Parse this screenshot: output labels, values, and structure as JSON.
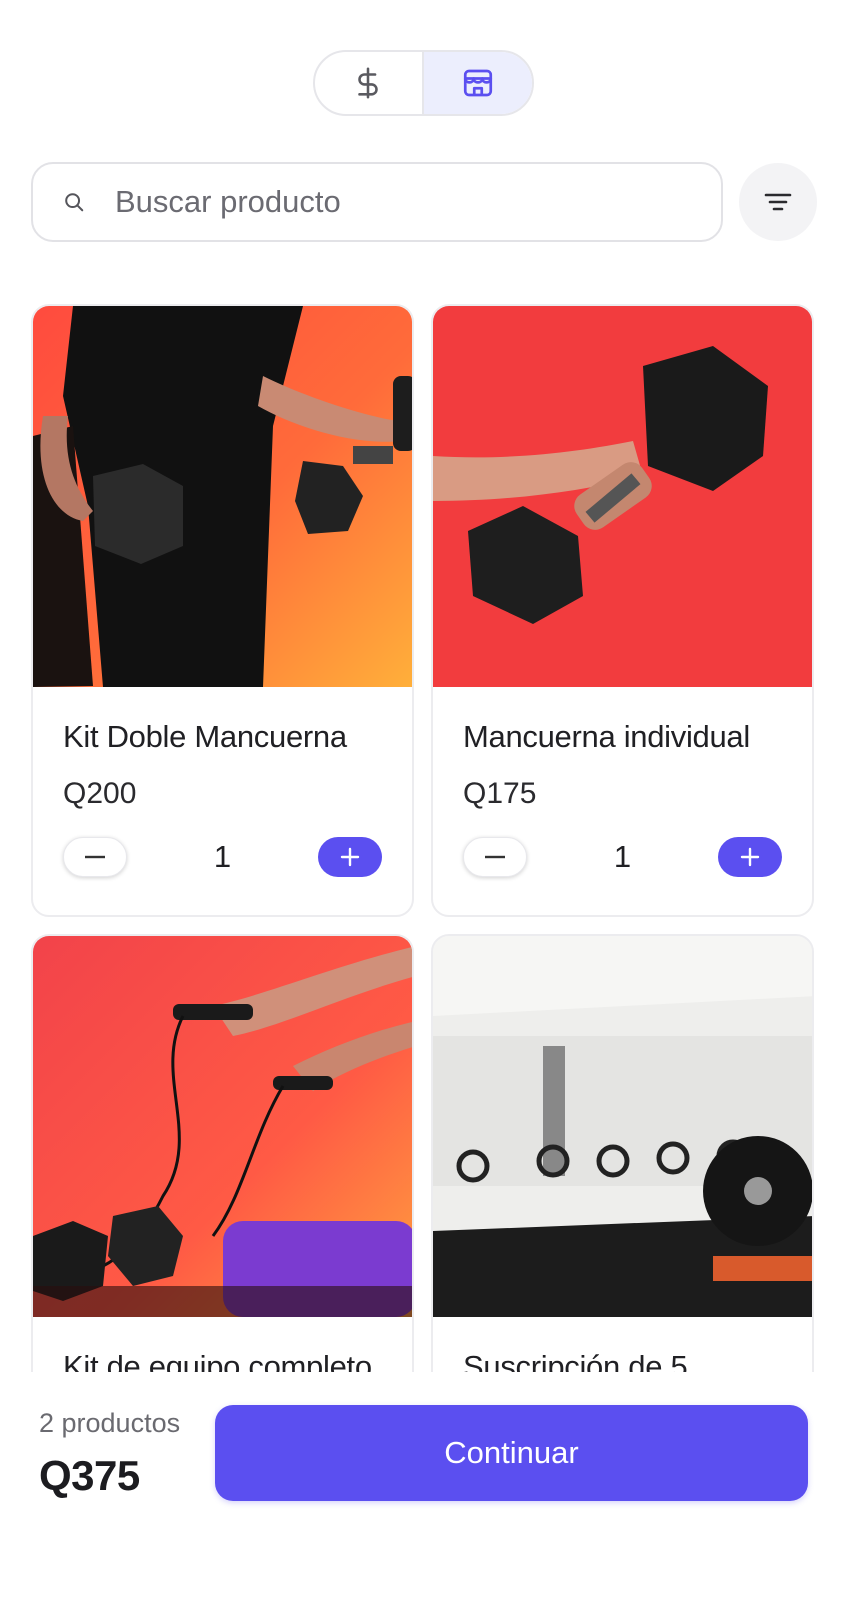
{
  "toggle": {
    "options": [
      {
        "icon": "dollar-icon",
        "active": false
      },
      {
        "icon": "store-icon",
        "active": true
      }
    ]
  },
  "search": {
    "placeholder": "Buscar producto",
    "value": ""
  },
  "filter": {
    "icon": "filter-icon"
  },
  "products": [
    {
      "name": "Kit Doble Mancuerna",
      "price": "Q200",
      "quantity": "1"
    },
    {
      "name": "Mancuerna individual",
      "price": "Q175",
      "quantity": "1"
    },
    {
      "name": "Kit de equipo completo",
      "price": "",
      "quantity": ""
    },
    {
      "name": "Suscripción de 5",
      "price": "",
      "quantity": ""
    }
  ],
  "footer": {
    "count_label": "2 productos",
    "total": "Q375",
    "cta_label": "Continuar"
  },
  "colors": {
    "accent": "#5b4ff0",
    "accent_soft": "#eceefd"
  }
}
